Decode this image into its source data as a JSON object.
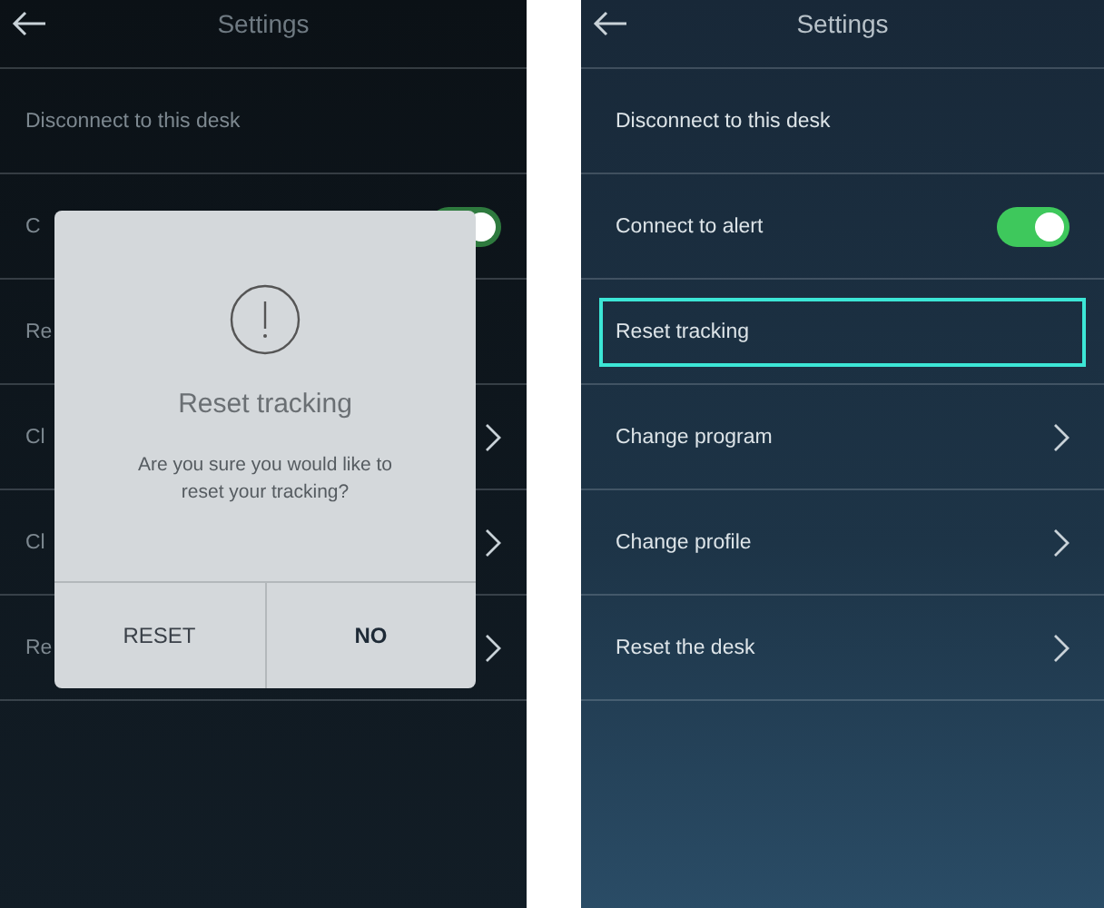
{
  "screens": [
    {
      "header": {
        "title": "Settings"
      },
      "rows": [
        {
          "kind": "plain",
          "label": "Disconnect to this desk",
          "selected": false
        },
        {
          "kind": "toggle",
          "label": "C",
          "on": true,
          "selected": false
        },
        {
          "kind": "plain",
          "label": "Re",
          "selected": false
        },
        {
          "kind": "chevron",
          "label": "Cl",
          "selected": false
        },
        {
          "kind": "chevron",
          "label": "Cl",
          "selected": false
        },
        {
          "kind": "chevron",
          "label": "Re",
          "selected": false
        }
      ],
      "dialog": {
        "title": "Reset tracking",
        "message": "Are you sure you would like to reset your tracking?",
        "buttons": [
          {
            "label": "RESET",
            "primary": false
          },
          {
            "label": "NO",
            "primary": true
          }
        ]
      }
    },
    {
      "header": {
        "title": "Settings"
      },
      "rows": [
        {
          "kind": "plain",
          "label": "Disconnect to this desk",
          "selected": false
        },
        {
          "kind": "toggle",
          "label": "Connect to alert",
          "on": true,
          "selected": false
        },
        {
          "kind": "plain",
          "label": "Reset tracking",
          "selected": true
        },
        {
          "kind": "chevron",
          "label": "Change program",
          "selected": false
        },
        {
          "kind": "chevron",
          "label": "Change profile",
          "selected": false
        },
        {
          "kind": "chevron",
          "label": "Reset the desk",
          "selected": false
        }
      ]
    }
  ]
}
